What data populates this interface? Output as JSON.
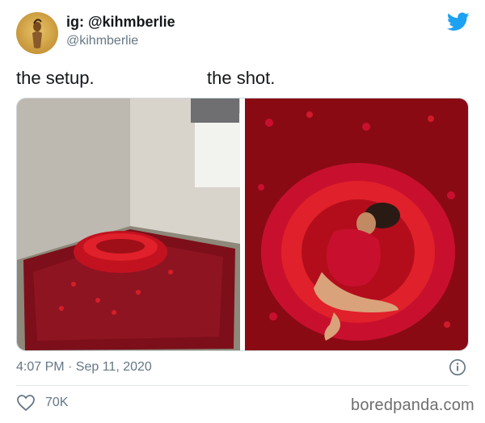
{
  "tweet": {
    "display_name": "ig: @kihmberlie",
    "handle": "@kihmberlie",
    "caption_left": "the setup.",
    "caption_right": "the shot.",
    "timestamp": "4:07 PM · Sep 11, 2020",
    "likes": "70K"
  },
  "icons": {
    "platform": "twitter-bird-icon",
    "info": "info-icon",
    "like": "heart-outline-icon"
  },
  "watermark": "boredpanda.com",
  "colors": {
    "twitter_blue": "#1da1f2",
    "muted_text": "#657786",
    "petal_red": "#c8102e",
    "backdrop_red": "#8a0a14"
  }
}
